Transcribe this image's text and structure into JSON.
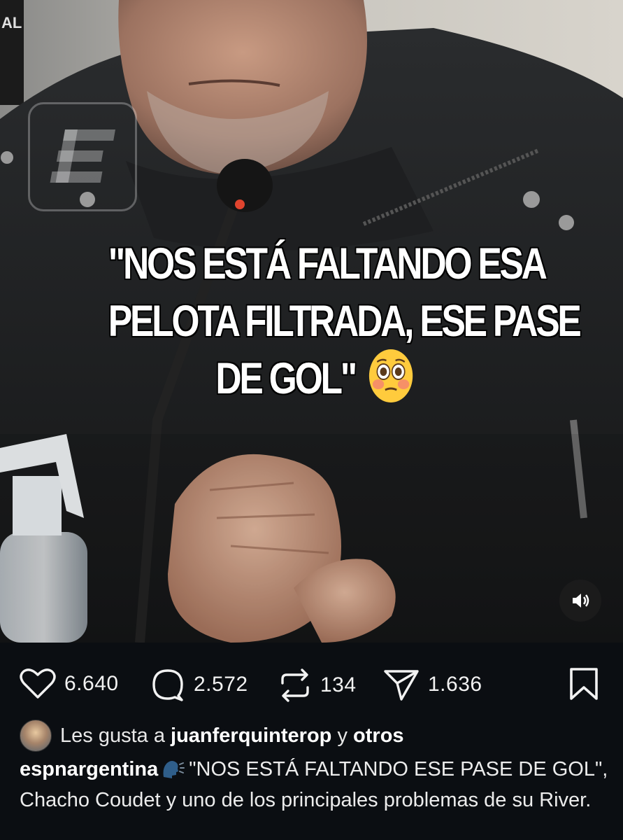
{
  "video": {
    "overlay_lines": [
      "\"NOS ESTÁ FALTANDO ESA",
      "PELOTA FILTRADA, ESE PASE",
      "DE GOL\""
    ],
    "overlay_emoji": "flushed-face",
    "watermark_icon": "espn-logo",
    "sound_icon": "speaker-icon",
    "background_badge": "AL"
  },
  "actions": {
    "likes": "6.640",
    "comments": "2.572",
    "reposts": "134",
    "shares": "1.636"
  },
  "liked_by": {
    "prefix": "Les gusta a",
    "user": "juanferquinterop",
    "connector": "y",
    "others": "otros"
  },
  "caption": {
    "user": "espnargentina",
    "icon": "speaking-head-icon",
    "text": "\"NOS ESTÁ FALTANDO ESE PASE DE GOL\", Chacho Coudet y uno de los principales problemas de su River."
  },
  "colors": {
    "background": "#0b0e12",
    "text": "#f2f2f2"
  }
}
